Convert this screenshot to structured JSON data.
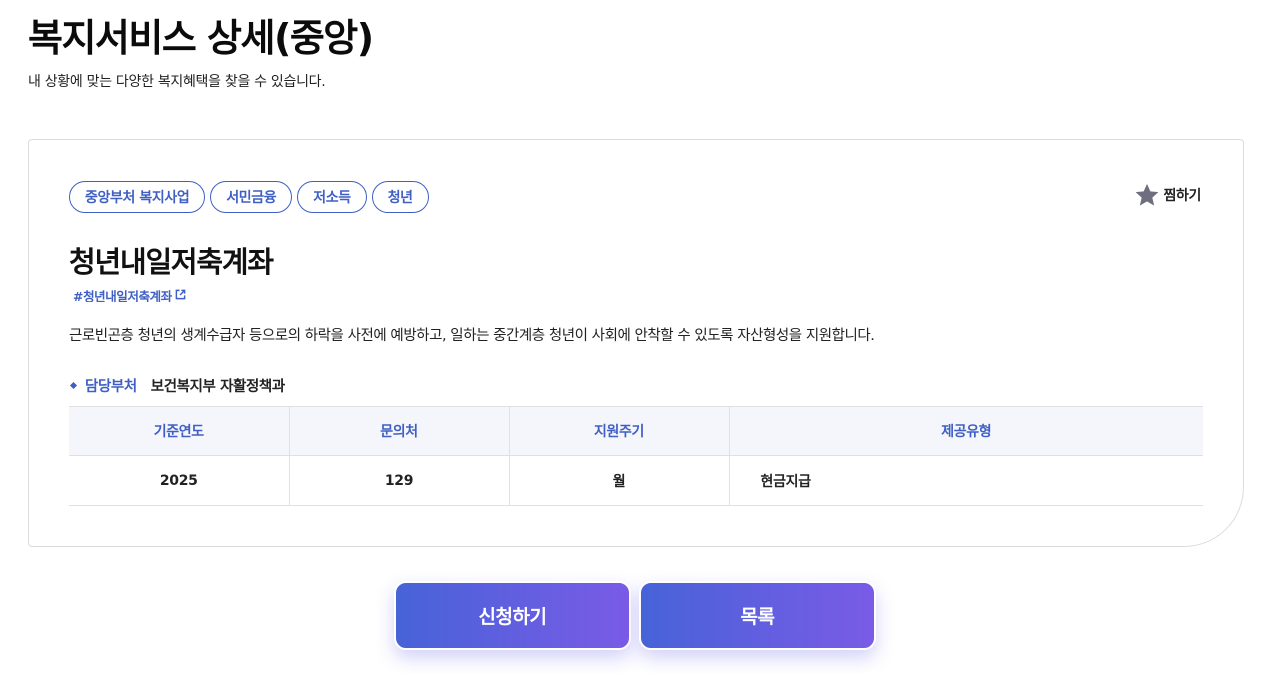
{
  "header": {
    "title": "복지서비스 상세(중앙)",
    "subtitle": "내 상황에 맞는 다양한 복지혜택을 찾을 수 있습니다."
  },
  "service": {
    "tags": [
      "중앙부처 복지사업",
      "서민금융",
      "저소득",
      "청년"
    ],
    "bookmark_label": "찜하기",
    "bookmark_icon": "star-icon",
    "title": "청년내일저축계좌",
    "hashtag": "#청년내일저축계좌",
    "description": "근로빈곤층 청년의 생계수급자 등으로의 하락을 사전에 예방하고, 일하는 중간계층 청년이 사회에 안착할 수 있도록 자산형성을 지원합니다.",
    "department": {
      "label": "담당부처",
      "value": "보건복지부 자활정책과"
    },
    "table": {
      "headers": [
        "기준연도",
        "문의처",
        "지원주기",
        "제공유형"
      ],
      "row": [
        "2025",
        "129",
        "월",
        "현금지급"
      ]
    }
  },
  "actions": {
    "apply_label": "신청하기",
    "list_label": "목록"
  },
  "colors": {
    "accent": "#3f5fc4",
    "button_gradient_start": "#4763d8",
    "button_gradient_end": "#7a5be6",
    "table_header_bg": "#f4f6fb",
    "star_icon": "#6e6e80"
  }
}
